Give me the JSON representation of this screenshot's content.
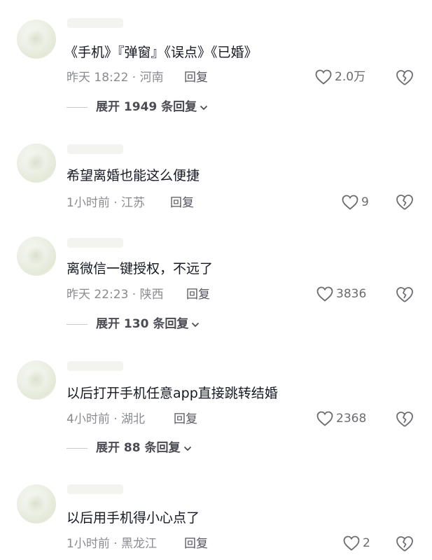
{
  "comments": [
    {
      "content": "《手机》『弹窗』《误点》《已婚》",
      "meta": "昨天 18:22 · 河南",
      "reply_label": "回复",
      "likes": "2.0万",
      "expand": "展开 1949 条回复"
    },
    {
      "content": "希望离婚也能这么便捷",
      "meta": "1小时前 · 江苏",
      "reply_label": "回复",
      "likes": "9"
    },
    {
      "content": "离微信一键授权，不远了",
      "meta": "昨天 22:23 · 陕西",
      "reply_label": "回复",
      "likes": "3836",
      "expand": "展开 130 条回复"
    },
    {
      "content": "以后打开手机任意app直接跳转结婚",
      "meta": "4小时前 · 湖北",
      "reply_label": "回复",
      "likes": "2368",
      "expand": "展开 88 条回复"
    },
    {
      "content": "以后用手机得小心点了",
      "meta": "1小时前 · 黑龙江",
      "reply_label": "回复",
      "likes": "2"
    }
  ],
  "icons": {
    "like": "heart-outline-icon",
    "dislike": "broken-heart-icon",
    "expand": "chevron-down-icon"
  },
  "colors": {
    "text": "#161823",
    "meta": "#8a8b91",
    "icon": "#6b6c72"
  }
}
